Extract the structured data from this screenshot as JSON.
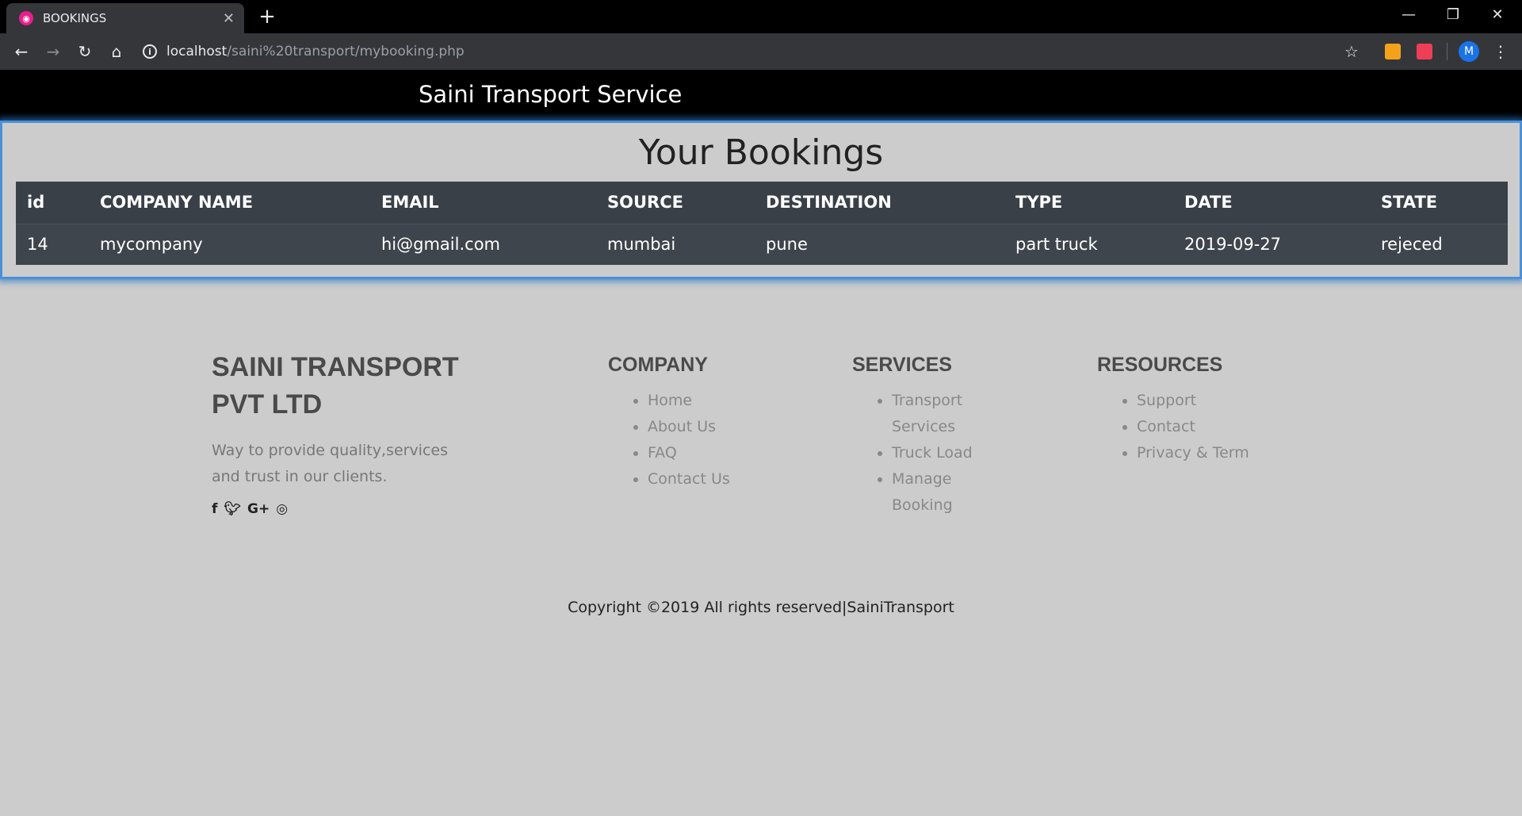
{
  "browser": {
    "tab_title": "BOOKINGS",
    "tab_close": "✕",
    "new_tab": "+",
    "url_host": "localhost",
    "url_path": "/saini%20transport/mybooking.php",
    "avatar_letter": "M",
    "window_controls": [
      "—",
      "❐",
      "✕"
    ]
  },
  "header": {
    "brand": "Saini Transport Service"
  },
  "bookings": {
    "title": "Your Bookings",
    "columns": [
      "id",
      "COMPANY NAME",
      "EMAIL",
      "SOURCE",
      "DESTINATION",
      "TYPE",
      "DATE",
      "STATE"
    ],
    "rows": [
      [
        "14",
        "mycompany",
        "hi@gmail.com",
        "mumbai",
        "pune",
        "part truck",
        "2019-09-27",
        "rejeced"
      ]
    ]
  },
  "footer": {
    "company_line1": "SAINI TRANSPORT",
    "company_line2": "PVT LTD",
    "tagline_line1": "Way to provide quality,services",
    "tagline_line2": "and trust in our clients.",
    "social_icons": [
      "facebook-icon",
      "twitter-icon",
      "google-plus-icon",
      "instagram-icon"
    ],
    "company": {
      "heading": "COMPANY",
      "links": [
        "Home",
        "About Us",
        "FAQ",
        "Contact Us"
      ]
    },
    "services": {
      "heading": "SERVICES",
      "links": [
        "Transport Services",
        "Truck Load",
        "Manage Booking"
      ]
    },
    "resources": {
      "heading": "RESOURCES",
      "links": [
        "Support",
        "Contact",
        "Privacy & Term"
      ]
    },
    "copyright": "Copyright ©2019 All rights reserved|SainiTransport"
  }
}
